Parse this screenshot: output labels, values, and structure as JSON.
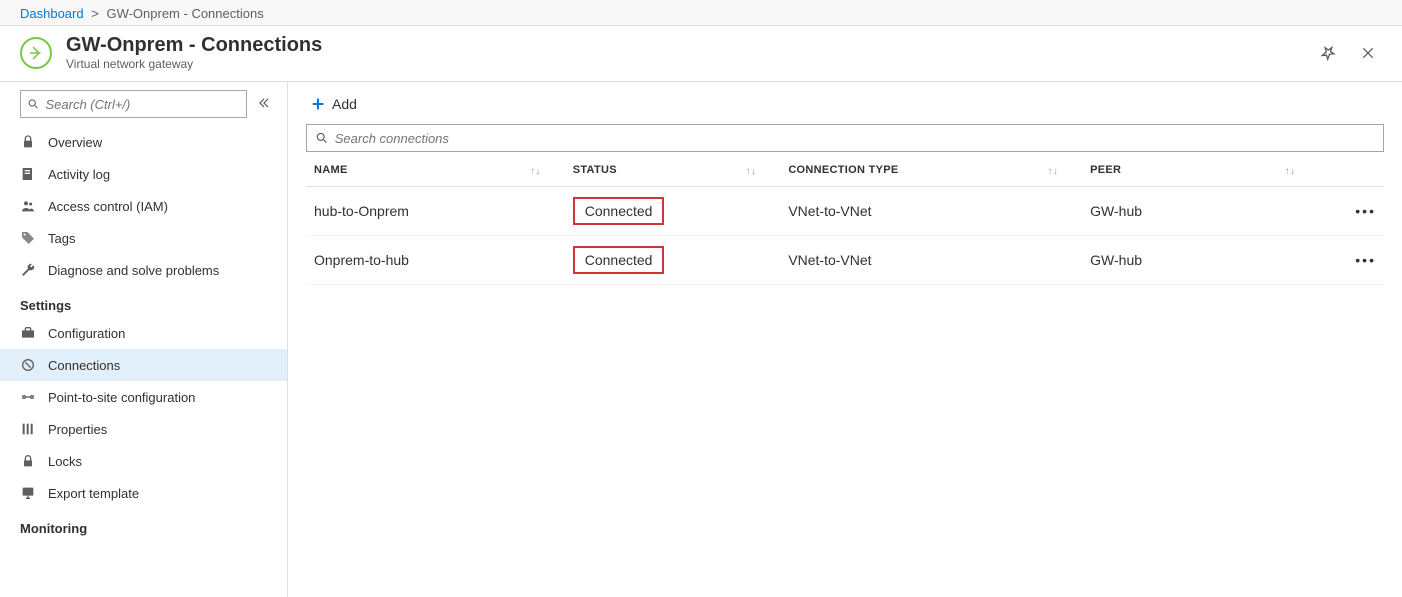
{
  "breadcrumb": {
    "root": "Dashboard",
    "current": "GW-Onprem - Connections"
  },
  "header": {
    "title": "GW-Onprem - Connections",
    "subtitle": "Virtual network gateway"
  },
  "sidebar": {
    "search_placeholder": "Search (Ctrl+/)",
    "items": [
      {
        "label": "Overview",
        "icon": "lock"
      },
      {
        "label": "Activity log",
        "icon": "log"
      },
      {
        "label": "Access control (IAM)",
        "icon": "people"
      },
      {
        "label": "Tags",
        "icon": "tag"
      },
      {
        "label": "Diagnose and solve problems",
        "icon": "wrench"
      }
    ],
    "group_settings": "Settings",
    "settings_items": [
      {
        "label": "Configuration",
        "icon": "toolbox"
      },
      {
        "label": "Connections",
        "icon": "circle",
        "active": true
      },
      {
        "label": "Point-to-site configuration",
        "icon": "p2s"
      },
      {
        "label": "Properties",
        "icon": "props"
      },
      {
        "label": "Locks",
        "icon": "padlock"
      },
      {
        "label": "Export template",
        "icon": "export"
      }
    ],
    "group_monitoring": "Monitoring"
  },
  "toolbar": {
    "add_label": "Add"
  },
  "filter": {
    "placeholder": "Search connections"
  },
  "table": {
    "columns": {
      "name": "NAME",
      "status": "STATUS",
      "type": "CONNECTION TYPE",
      "peer": "PEER"
    },
    "rows": [
      {
        "name": "hub-to-Onprem",
        "status": "Connected",
        "type": "VNet-to-VNet",
        "peer": "GW-hub"
      },
      {
        "name": "Onprem-to-hub",
        "status": "Connected",
        "type": "VNet-to-VNet",
        "peer": "GW-hub"
      }
    ]
  }
}
